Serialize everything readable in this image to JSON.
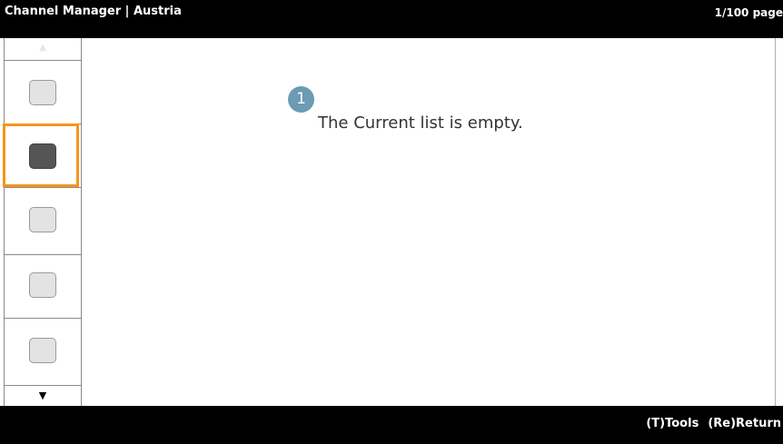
{
  "header": {
    "title": "Channel Manager | Austria",
    "pager": "1/100 page"
  },
  "sidebar": {
    "up_arrow": "▲",
    "down_arrow": "▼",
    "slots": [
      {
        "state": "normal"
      },
      {
        "state": "selected"
      },
      {
        "state": "normal"
      },
      {
        "state": "normal"
      },
      {
        "state": "normal"
      }
    ]
  },
  "main": {
    "step_number": "1",
    "message": "The Current list is empty."
  },
  "footer": {
    "tools": "(T)Tools",
    "return": "(Re)Return"
  },
  "colors": {
    "highlight": "#f7941d",
    "step_badge": "#6b9bb5",
    "bar": "#000000"
  }
}
